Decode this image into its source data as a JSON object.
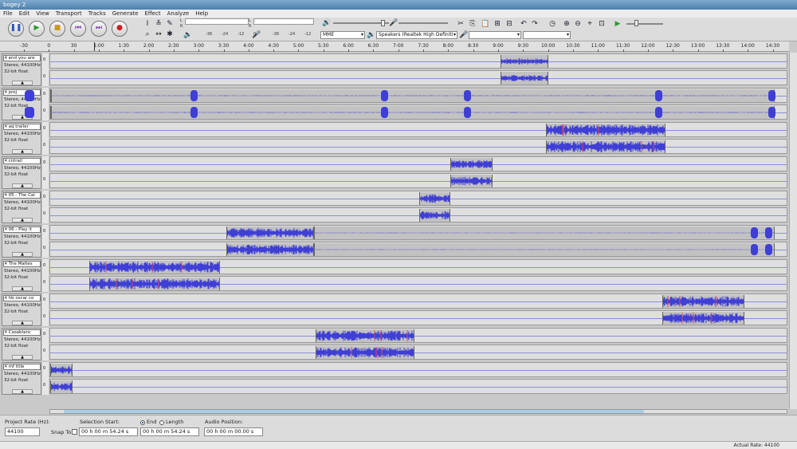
{
  "window": {
    "title": "bogey 2"
  },
  "menu": [
    "File",
    "Edit",
    "View",
    "Transport",
    "Tracks",
    "Generate",
    "Effect",
    "Analyze",
    "Help"
  ],
  "transport": {
    "buttons": [
      {
        "name": "pause-button",
        "glyph": "❚❚",
        "color": "#2a55b8"
      },
      {
        "name": "play-button",
        "glyph": "▶",
        "color": "#2a9d2a"
      },
      {
        "name": "stop-button",
        "glyph": "■",
        "color": "#c79a1b"
      },
      {
        "name": "skip-start-button",
        "glyph": "⏮",
        "color": "#7a3bb5"
      },
      {
        "name": "skip-end-button",
        "glyph": "⏭",
        "color": "#7a3bb5"
      },
      {
        "name": "record-button",
        "glyph": "●",
        "color": "#cc1f1f"
      }
    ]
  },
  "meters": {
    "left_label": "L",
    "right_label": "R",
    "scale": [
      "-36",
      "-24",
      "-12",
      "0"
    ]
  },
  "device": {
    "host": "MME",
    "output": "Speakers (Realtek High Definiti",
    "input": "",
    "channels": ""
  },
  "ruler": {
    "labels": [
      "-30",
      "0",
      "30",
      "1:00",
      "1:30",
      "2:00",
      "2:30",
      "3:00",
      "3:30",
      "4:00",
      "4:30",
      "5:00",
      "5:30",
      "6:00",
      "6:30",
      "7:00",
      "7:30",
      "8:00",
      "8:30",
      "9:00",
      "9:30",
      "10:00",
      "10:30",
      "11:00",
      "11:30",
      "12:00",
      "12:30",
      "13:00",
      "13:30",
      "14:00",
      "14:30"
    ],
    "x0_label_seconds": -30,
    "seconds_per_label": 30
  },
  "tracks": [
    {
      "name": "end you are",
      "info1": "Stereo, 44100Hz",
      "info2": "32-bit float",
      "clips": [
        {
          "start": 540,
          "end": 597,
          "density": 0.5
        }
      ]
    },
    {
      "name": "proj",
      "info1": "Stereo, 44100Hz",
      "info2": "32-bit float",
      "clips": [
        {
          "start": -30,
          "end": 0,
          "density": 0.3
        },
        {
          "start": 0,
          "end": 870,
          "density": 0.05
        }
      ],
      "bursts": [
        -28,
        -25,
        171,
        400,
        500,
        730,
        866
      ]
    },
    {
      "name": "aq trailer",
      "info1": "Stereo, 44100Hz",
      "info2": "32-bit float",
      "clips": [
        {
          "start": 595,
          "end": 738,
          "density": 0.9
        }
      ]
    },
    {
      "name": "cntrail",
      "info1": "Stereo, 44100Hz",
      "info2": "32-bit float",
      "clips": [
        {
          "start": 480,
          "end": 530,
          "density": 0.7
        }
      ]
    },
    {
      "name": "05 - The Cai",
      "info1": "Stereo, 44100Hz",
      "info2": "32-bit float",
      "clips": [
        {
          "start": 442,
          "end": 480,
          "density": 0.7
        }
      ]
    },
    {
      "name": "06 - Play it",
      "info1": "Stereo, 44100Hz",
      "info2": "32-bit float",
      "clips": [
        {
          "start": 210,
          "end": 316,
          "density": 0.8
        },
        {
          "start": 316,
          "end": 870,
          "density": 0.04
        }
      ],
      "bursts": [
        845,
        862
      ]
    },
    {
      "name": "The Maltes",
      "info1": "Stereo, 44100Hz",
      "info2": "32-bit float",
      "clips": [
        {
          "start": 46,
          "end": 203,
          "density": 0.9
        }
      ]
    },
    {
      "name": "hb oscar co",
      "info1": "Stereo, 44100Hz",
      "info2": "32-bit float",
      "clips": [
        {
          "start": 734,
          "end": 833,
          "density": 0.85
        }
      ]
    },
    {
      "name": "Casablanc",
      "info1": "Stereo, 44100Hz",
      "info2": "32-bit float",
      "clips": [
        {
          "start": 318,
          "end": 437,
          "density": 0.85
        }
      ]
    },
    {
      "name": "mf title",
      "info1": "Stereo, 44100Hz",
      "info2": "32-bit float",
      "clips": [
        {
          "start": -26,
          "end": 26,
          "density": 0.7
        }
      ]
    }
  ],
  "bottom": {
    "project_rate_label": "Project Rate (Hz):",
    "project_rate_value": "44100",
    "snap_label": "Snap To",
    "selection_start_label": "Selection Start:",
    "end_label": "End",
    "length_label": "Length",
    "selection_start": "00 h 00 m 54.24 s",
    "selection_end": "00 h 00 m 54.24 s",
    "audio_position_label": "Audio Position:",
    "audio_position": "00 h 00 m 00.00 s"
  },
  "status": {
    "actual_rate": "Actual Rate: 44100"
  },
  "colors": {
    "wave": "#3f3fd6",
    "wave_clip": "#d14b6a",
    "clip_bg": "#c2c2c2"
  }
}
